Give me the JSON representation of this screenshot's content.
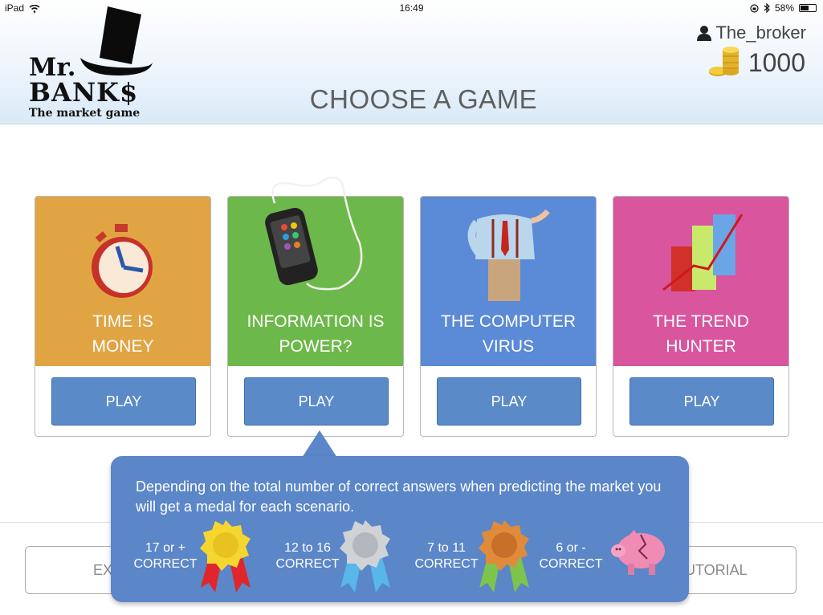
{
  "status_bar": {
    "device": "iPad",
    "time": "16:49",
    "battery": "58%",
    "battery_level": 0.58
  },
  "logo": {
    "line1": "Mr.",
    "line2": "BANK$",
    "tagline": "The market game"
  },
  "header": {
    "title": "CHOOSE A GAME",
    "username": "The_broker",
    "coins": "1000"
  },
  "icons": {
    "user": "person-icon",
    "coins": "coin-stack-icon",
    "wifi": "wifi-icon",
    "bluetooth": "bluetooth-icon",
    "lock": "rotation-lock-icon"
  },
  "games": [
    {
      "title_line1": "TIME IS",
      "title_line2": "MONEY",
      "play": "PLAY",
      "color": "#e0a443",
      "icon": "stopwatch-icon"
    },
    {
      "title_line1": "INFORMATION IS",
      "title_line2": "POWER?",
      "play": "PLAY",
      "color": "#6db84a",
      "icon": "smartphone-earphones-icon"
    },
    {
      "title_line1": "THE COMPUTER",
      "title_line2": "VIRUS",
      "play": "PLAY",
      "color": "#5b8ad6",
      "icon": "businessman-icon"
    },
    {
      "title_line1": "THE TREND",
      "title_line2": "HUNTER",
      "play": "PLAY",
      "color": "#d9559e",
      "icon": "bar-chart-icon"
    }
  ],
  "bottom_buttons": {
    "left": "EX",
    "right": "UTORIAL"
  },
  "tooltip": {
    "message": "Depending on the total number of correct answers when predicting the market you will get a medal for each scenario.",
    "medals": [
      {
        "range": "17 or +",
        "label": "CORRECT",
        "icon": "gold-medal-icon"
      },
      {
        "range": "12 to 16",
        "label": "CORRECT",
        "icon": "silver-medal-icon"
      },
      {
        "range": "7 to 11",
        "label": "CORRECT",
        "icon": "bronze-medal-icon"
      },
      {
        "range": "6 or -",
        "label": "CORRECT",
        "icon": "broken-piggy-bank-icon"
      }
    ]
  }
}
